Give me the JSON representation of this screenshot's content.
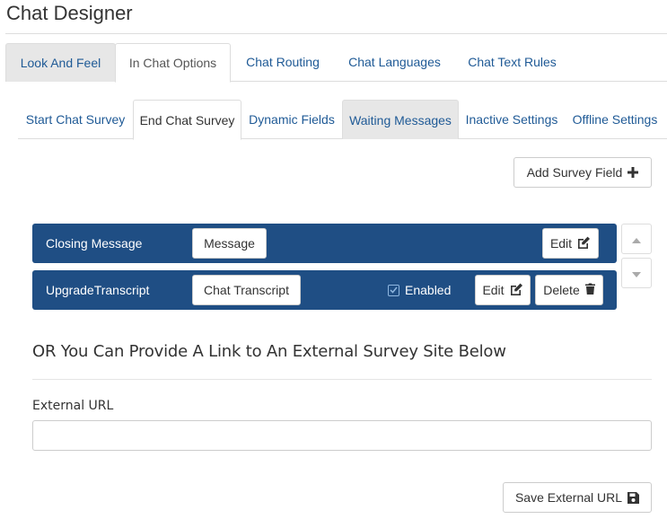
{
  "page": {
    "title": "Chat Designer"
  },
  "primary_tabs": [
    {
      "label": "Look And Feel",
      "state": "grey"
    },
    {
      "label": "In Chat Options",
      "state": "active"
    },
    {
      "label": "Chat Routing",
      "state": "normal"
    },
    {
      "label": "Chat Languages",
      "state": "normal"
    },
    {
      "label": "Chat Text Rules",
      "state": "normal"
    }
  ],
  "secondary_tabs": [
    {
      "label": "Start Chat Survey",
      "state": "normal"
    },
    {
      "label": "End Chat Survey",
      "state": "active"
    },
    {
      "label": "Dynamic Fields",
      "state": "normal"
    },
    {
      "label": "Waiting Messages",
      "state": "grey"
    },
    {
      "label": "Inactive Settings",
      "state": "normal"
    },
    {
      "label": "Offline Settings",
      "state": "normal"
    }
  ],
  "toolbar": {
    "add_survey_field_label": "Add Survey Field",
    "add_icon": "plus-icon"
  },
  "survey_fields": [
    {
      "name": "Closing Message",
      "type_label": "Message",
      "edit_label": "Edit"
    },
    {
      "name": "UpgradeTranscript",
      "type_label": "Chat Transcript",
      "enabled_label": "Enabled",
      "enabled": true,
      "edit_label": "Edit",
      "delete_label": "Delete"
    }
  ],
  "external": {
    "heading": "OR You Can Provide A Link to An External Survey Site Below",
    "url_label": "External URL",
    "url_value": "",
    "save_label": "Save External URL"
  },
  "colors": {
    "row_bg": "#1f4e84",
    "link": "#1f5a96",
    "tab_grey": "#e7e7e7"
  }
}
